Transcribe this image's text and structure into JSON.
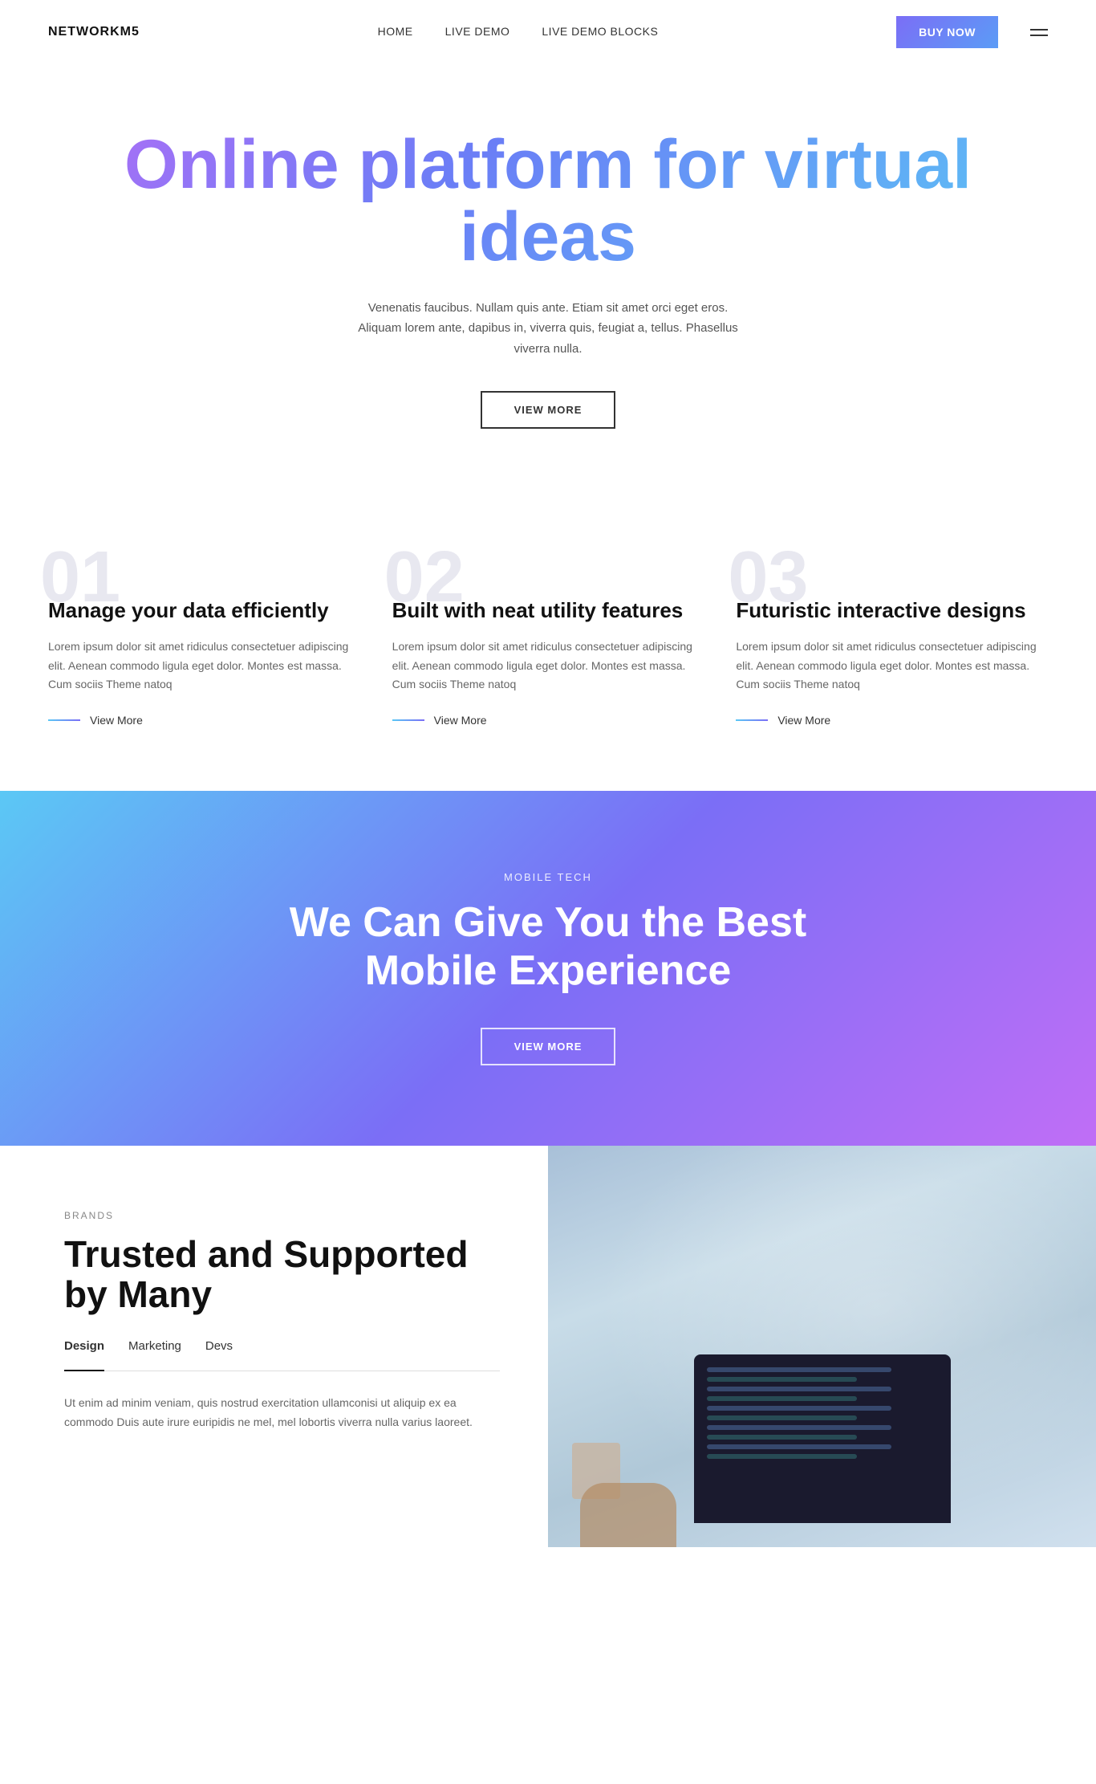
{
  "nav": {
    "logo": "NETWORKM5",
    "links": [
      {
        "label": "HOME",
        "href": "#"
      },
      {
        "label": "LIVE DEMO",
        "href": "#"
      },
      {
        "label": "LIVE DEMO BLOCKS",
        "href": "#"
      }
    ],
    "buy_label": "BUY NOW"
  },
  "hero": {
    "title": "Online platform for virtual ideas",
    "subtitle": "Venenatis faucibus. Nullam quis ante. Etiam sit amet orci eget eros. Aliquam lorem ante, dapibus in, viverra quis, feugiat a, tellus. Phasellus viverra nulla.",
    "cta_label": "VIEW MORE"
  },
  "features": [
    {
      "number": "01",
      "title": "Manage your data efficiently",
      "desc": "Lorem ipsum dolor sit amet ridiculus consectetuer adipiscing elit. Aenean commodo ligula eget dolor. Montes est massa. Cum sociis Theme natoq",
      "link_label": "View More"
    },
    {
      "number": "02",
      "title": "Built with neat utility features",
      "desc": "Lorem ipsum dolor sit amet ridiculus consectetuer adipiscing elit. Aenean commodo ligula eget dolor. Montes est massa. Cum sociis Theme natoq",
      "link_label": "View More"
    },
    {
      "number": "03",
      "title": "Futuristic interactive designs",
      "desc": "Lorem ipsum dolor sit amet ridiculus consectetuer adipiscing elit. Aenean commodo ligula eget dolor. Montes est massa. Cum sociis Theme natoq",
      "link_label": "View More"
    }
  ],
  "mobile_banner": {
    "tag": "MOBILE TECH",
    "title": "We Can Give You the Best Mobile Experience",
    "cta_label": "VIEW MORE"
  },
  "brands": {
    "tag": "BRANDS",
    "title": "Trusted and Supported by Many",
    "tabs": [
      {
        "label": "Design",
        "active": true
      },
      {
        "label": "Marketing",
        "active": false
      },
      {
        "label": "Devs",
        "active": false
      }
    ],
    "desc": "Ut enim ad minim veniam, quis nostrud exercitation ullamconisi ut aliquip ex ea commodo Duis aute irure euripidis ne mel, mel lobortis viverra nulla varius laoreet."
  }
}
